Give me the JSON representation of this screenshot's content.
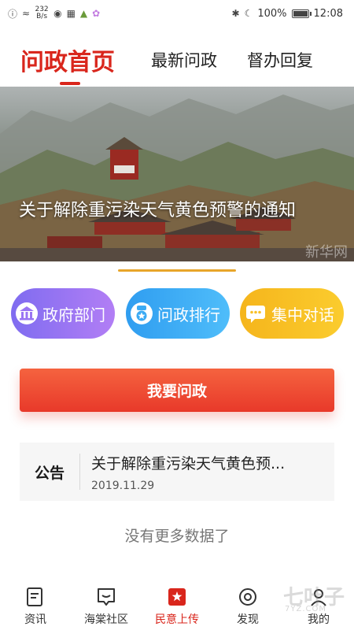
{
  "status_bar": {
    "speed": "232\nB/s",
    "battery": "100%",
    "battery_level": 1.0,
    "time": "12:08"
  },
  "tabs": [
    {
      "label": "问政首页",
      "active": true
    },
    {
      "label": "最新问政",
      "active": false
    },
    {
      "label": "督办回复",
      "active": false
    }
  ],
  "banner": {
    "title": "关于解除重污染天气黄色预警的通知",
    "watermark": "新华网"
  },
  "quick_actions": [
    {
      "label": "政府部门",
      "icon": "building-icon",
      "color": "#9a75f3"
    },
    {
      "label": "问政排行",
      "icon": "medal-icon",
      "color": "#3aaaf4"
    },
    {
      "label": "集中对话",
      "icon": "chat-bubble-icon",
      "color": "#f8c026"
    }
  ],
  "ask_button": "我要问政",
  "notice": {
    "tag": "公告",
    "title": "关于解除重污染天气黄色预...",
    "date": "2019.11.29"
  },
  "no_more": "没有更多数据了",
  "bottom_nav": [
    {
      "label": "资讯",
      "icon": "news-icon",
      "active": false
    },
    {
      "label": "海棠社区",
      "icon": "community-icon",
      "active": false
    },
    {
      "label": "民意上传",
      "icon": "upload-opinion-icon",
      "active": true
    },
    {
      "label": "发现",
      "icon": "discover-icon",
      "active": false
    },
    {
      "label": "我的",
      "icon": "profile-icon",
      "active": false
    }
  ],
  "corner_logo": {
    "text": "七叶子",
    "sub": "7YZ.COM"
  },
  "colors": {
    "accent": "#d9261c",
    "ask_button": "#ec4530"
  }
}
